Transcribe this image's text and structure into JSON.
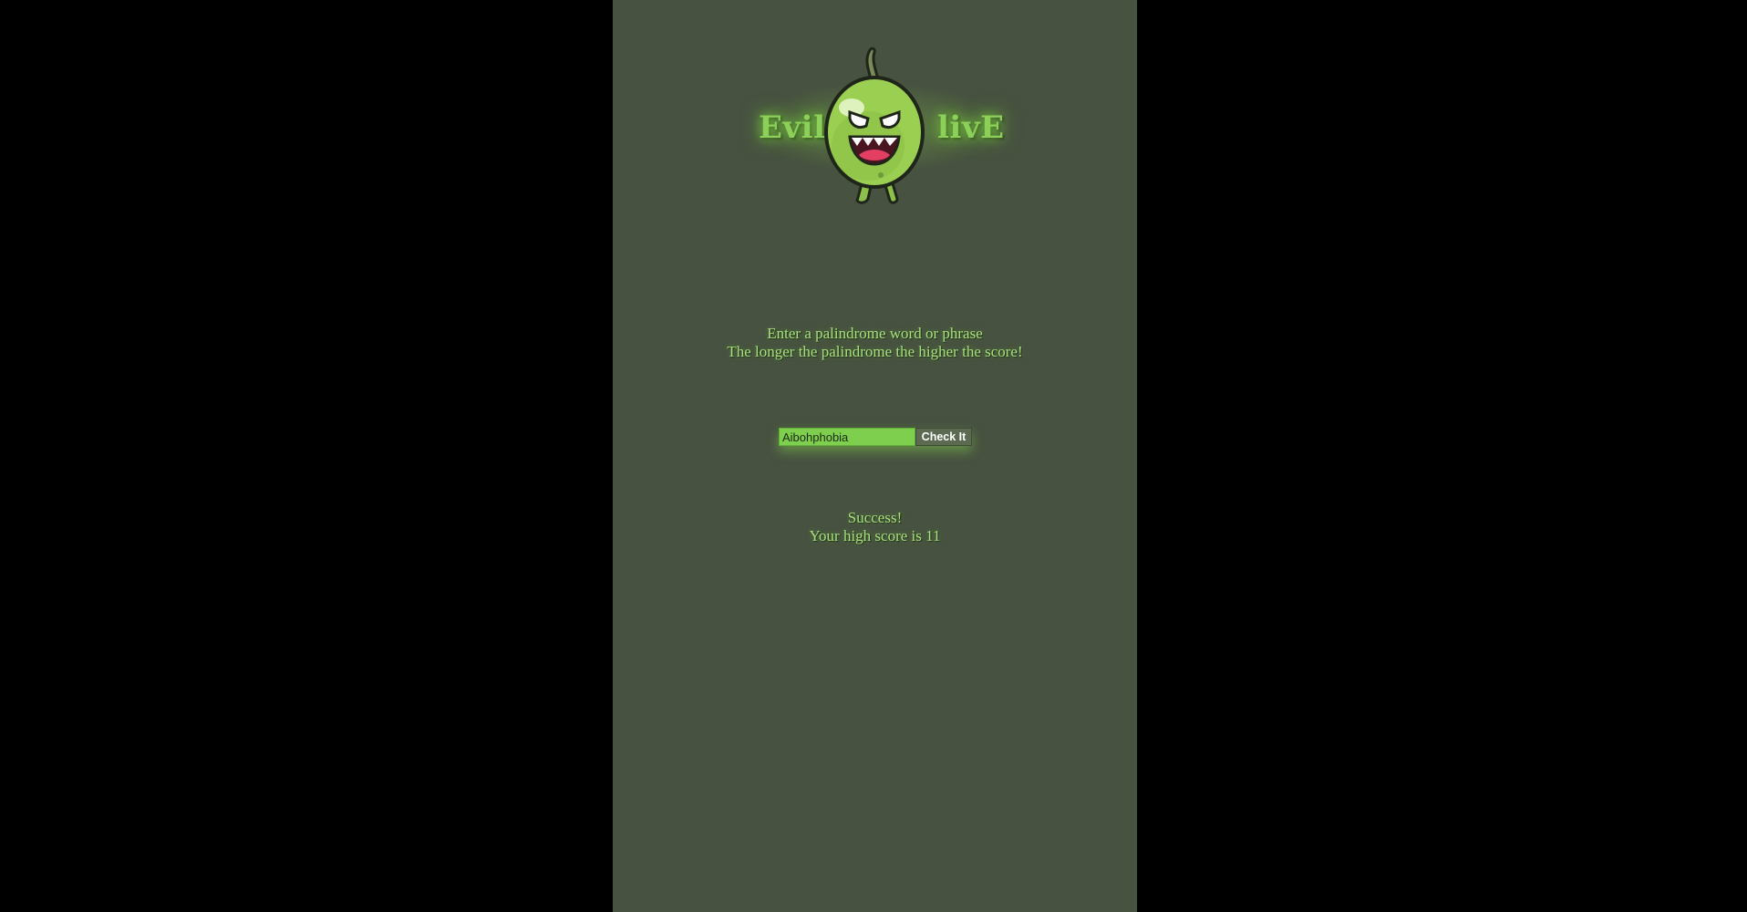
{
  "logo": {
    "left_word": "Evil",
    "right_word": "livE",
    "mascot_icon": "angry-olive-mascot-icon"
  },
  "instructions": {
    "line1": "Enter a palindrome word or phrase",
    "line2": "The longer the palindrome the higher the score!"
  },
  "form": {
    "input_value": "Aibohphobia",
    "button_label": "Check It"
  },
  "result": {
    "status": "Success!",
    "score_text": "Your high score is 11"
  },
  "colors": {
    "page_background": "#475240",
    "outer_background": "#000000",
    "text_green": "#a7e07c",
    "input_green": "#7fcf4e",
    "button_gray_green": "#5c6a52"
  }
}
